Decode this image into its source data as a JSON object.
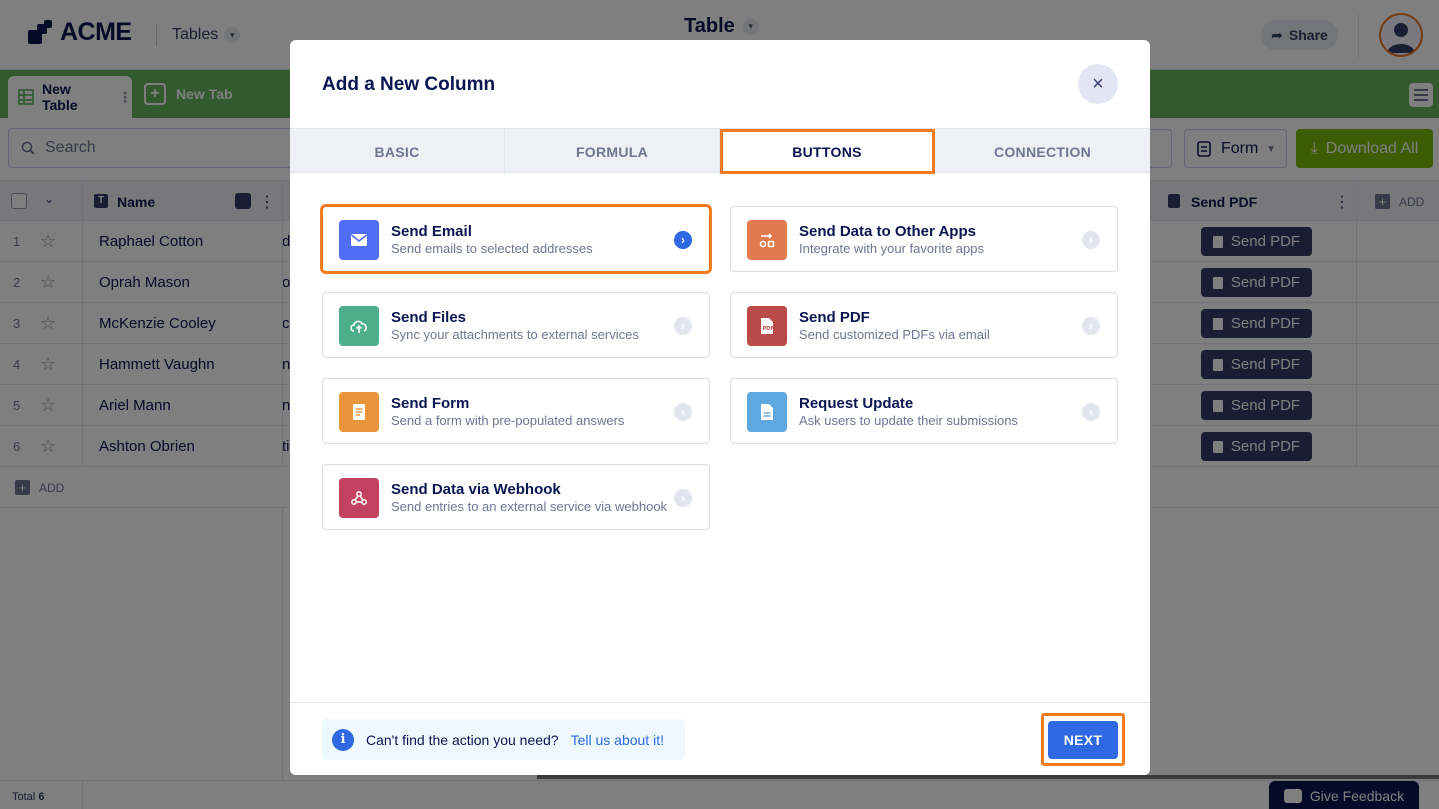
{
  "header": {
    "logo_text": "ACME",
    "tables_label": "Tables",
    "title": "Table",
    "share_label": "Share"
  },
  "tabs": {
    "active": "New Table",
    "new_tab": "New Tab"
  },
  "toolbar": {
    "search_placeholder": "Search",
    "form_label": "Form",
    "download_label": "Download All"
  },
  "grid": {
    "columns": [
      "Name",
      "Send PDF"
    ],
    "add_column_label": "ADD",
    "rows": [
      {
        "num": "1",
        "name": "Raphael Cotton",
        "c2": "d",
        "button": "Send PDF"
      },
      {
        "num": "2",
        "name": "Oprah Mason",
        "c2": "o",
        "button": "Send PDF"
      },
      {
        "num": "3",
        "name": "McKenzie Cooley",
        "c2": "c",
        "button": "Send PDF"
      },
      {
        "num": "4",
        "name": "Hammett Vaughn",
        "c2": "n",
        "button": "Send PDF"
      },
      {
        "num": "5",
        "name": "Ariel Mann",
        "c2": "n",
        "button": "Send PDF"
      },
      {
        "num": "6",
        "name": "Ashton Obrien",
        "c2": "ti",
        "button": "Send PDF"
      }
    ],
    "add_row_label": "ADD",
    "total_label": "Total",
    "total_value": "6"
  },
  "feedback_label": "Give Feedback",
  "modal": {
    "title": "Add a New Column",
    "tabs": [
      "BASIC",
      "FORMULA",
      "BUTTONS",
      "CONNECTION"
    ],
    "active_tab": "BUTTONS",
    "cards": [
      {
        "title": "Send Email",
        "desc": "Send emails to selected addresses",
        "icon": "mail-icon",
        "color": "#4f6df5",
        "selected": true
      },
      {
        "title": "Send Data to Other Apps",
        "desc": "Integrate with your favorite apps",
        "icon": "integration-icon",
        "color": "#e07a4f"
      },
      {
        "title": "Send Files",
        "desc": "Sync your attachments to external services",
        "icon": "cloud-upload-icon",
        "color": "#4cae8b"
      },
      {
        "title": "Send PDF",
        "desc": "Send customized PDFs via email",
        "icon": "pdf-icon",
        "color": "#b94a48"
      },
      {
        "title": "Send Form",
        "desc": "Send a form with pre-populated answers",
        "icon": "form-icon",
        "color": "#e8943a"
      },
      {
        "title": "Request Update",
        "desc": "Ask users to update their submissions",
        "icon": "document-icon",
        "color": "#5fa8e0"
      },
      {
        "title": "Send Data via Webhook",
        "desc": "Send entries to an external service via webhook",
        "icon": "webhook-icon",
        "color": "#c2425f"
      }
    ],
    "footer": {
      "info_text": "Can't find the action you need?",
      "info_link": "Tell us about it!",
      "next_label": "NEXT"
    }
  }
}
